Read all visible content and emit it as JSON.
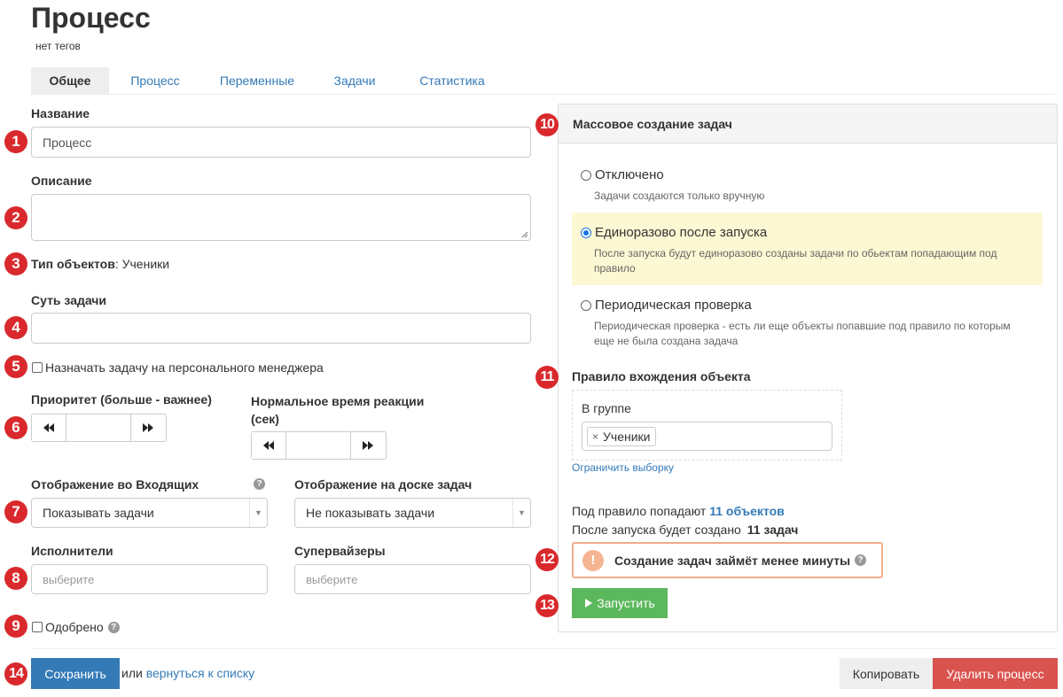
{
  "header": {
    "title": "Процесс",
    "tags": "нет тегов"
  },
  "tabs": [
    {
      "label": "Общее"
    },
    {
      "label": "Процесс"
    },
    {
      "label": "Переменные"
    },
    {
      "label": "Задачи"
    },
    {
      "label": "Статистика"
    }
  ],
  "badges": [
    "1",
    "2",
    "3",
    "4",
    "5",
    "6",
    "7",
    "8",
    "9",
    "10",
    "11",
    "12",
    "13",
    "14"
  ],
  "form": {
    "name_label": "Название",
    "name_value": "Процесс",
    "description_label": "Описание",
    "object_type_label": "Тип объектов",
    "object_type_value": ": Ученики",
    "task_essence_label": "Суть задачи",
    "assign_manager_label": "Назначать задачу на персонального менеджера",
    "priority_label": "Приоритет (больше - важнее)",
    "reaction_label": "Нормальное время реакции (сек)",
    "inbox_display_label": "Отображение во Входящих",
    "inbox_display_value": "Показывать задачи",
    "board_display_label": "Отображение на доске задач",
    "board_display_value": "Не показывать задачи",
    "executors_label": "Исполнители",
    "executors_placeholder": "выберите",
    "supervisors_label": "Супервайзеры",
    "supervisors_placeholder": "выберите",
    "approved_label": "Одобрено"
  },
  "mass": {
    "title": "Массовое создание задач",
    "options": [
      {
        "title": "Отключено",
        "desc": "Задачи создаются только вручную"
      },
      {
        "title": "Единоразово после запуска",
        "desc": "После запуска будут единоразово созданы задачи по обьектам попадающим под правило"
      },
      {
        "title": "Периодическая проверка",
        "desc": "Периодическая проверка - есть ли еще объекты попавшие под правило по которым еще не была создана задача"
      }
    ],
    "selected_option": 1,
    "rule_title": "Правило вхождения объекта",
    "group_label": "В группе",
    "group_tag": "Ученики",
    "limit_link": "Ограничить выборку",
    "count_prefix": "Под правило попадают ",
    "count_link": "11 объектов",
    "created_prefix": "После запуска будет создано ",
    "created_value": "11 задач",
    "warning_text": "Создание задач займёт менее минуты",
    "run_button": "Запустить"
  },
  "footer": {
    "save_button": "Сохранить",
    "or_text": "или",
    "back_link": "вернуться к списку",
    "copy_button": "Копировать",
    "delete_button": "Удалить процесс"
  },
  "colors": {
    "badge": "#d9292c",
    "link": "#337ab7",
    "primary": "#337ab7",
    "success": "#5cb85c",
    "danger": "#d9534f",
    "highlight": "#fcf8d3",
    "warning_border": "#f0ad8a"
  }
}
